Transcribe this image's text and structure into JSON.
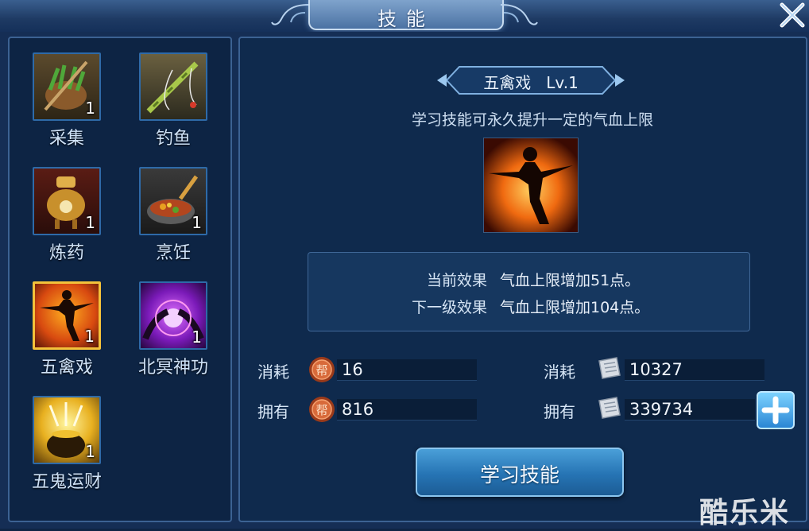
{
  "window": {
    "title": "技能"
  },
  "skills": [
    {
      "label": "采集",
      "level": "1",
      "icon": "gathering-basket-icon"
    },
    {
      "label": "钓鱼",
      "level": "",
      "icon": "fishing-rod-icon"
    },
    {
      "label": "炼药",
      "level": "1",
      "icon": "alchemy-furnace-icon"
    },
    {
      "label": "烹饪",
      "level": "1",
      "icon": "cooking-wok-icon"
    },
    {
      "label": "五禽戏",
      "level": "1",
      "icon": "martial-pose-icon",
      "selected": true
    },
    {
      "label": "北冥神功",
      "level": "1",
      "icon": "purple-energy-icon"
    },
    {
      "label": "五鬼运财",
      "level": "1",
      "icon": "treasure-pot-icon"
    }
  ],
  "detail": {
    "name": "五禽戏",
    "level": "Lv.1",
    "description": "学习技能可永久提升一定的气血上限",
    "current_label": "当前效果",
    "current_value": "气血上限增加51点。",
    "next_label": "下一级效果",
    "next_value": "气血上限增加104点。"
  },
  "resources": {
    "cost_label": "消耗",
    "own_label": "拥有",
    "guild_coin": {
      "icon": "guild-coin-icon",
      "coin_text": "帮",
      "cost": "16",
      "owned": "816"
    },
    "silver": {
      "icon": "silver-ticket-icon",
      "cost": "10327",
      "owned": "339734"
    }
  },
  "learn_button": "学习技能",
  "watermark": "酷乐米",
  "colors": {
    "accent": "#2674b4",
    "selected": "#f4c23a",
    "coin": "#c9623a"
  }
}
